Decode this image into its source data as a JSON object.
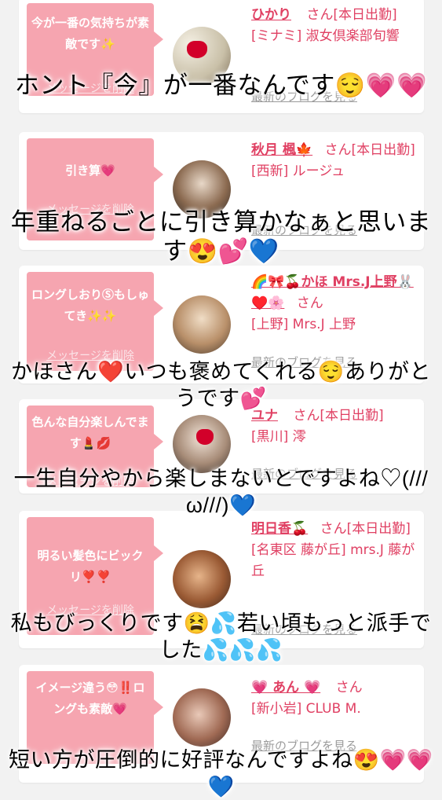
{
  "cards": [
    {
      "bubble_text": "今が一番の気持ちが素敵です✨",
      "delete_label": "メッセージを削除",
      "name": "ひかり",
      "status": "さん[本日出勤]",
      "shop": "[ミナミ] 淑女倶楽部旬響",
      "blog_label": "最新のブログを見る"
    },
    {
      "bubble_text": "引き算💗",
      "delete_label": "メッセージを削除",
      "name": "秋月 楓🍁",
      "status": "さん[本日出勤]",
      "shop": "[西新] ルージュ",
      "blog_label": "最新のブログを見る"
    },
    {
      "bubble_text": "ロングしおりⓈもしゅてき✨✨",
      "delete_label": "メッセージを削除",
      "name": "🌈🎀🍒かほ Mrs.J上野🐰♥️🌸",
      "status": "さん",
      "shop": "[上野] Mrs.J 上野",
      "blog_label": "最新のブログを見る"
    },
    {
      "bubble_text": "色んな自分楽しんでます💄💋",
      "delete_label": "メッセージを削除",
      "name": "ユナ",
      "status": "さん[本日出勤]",
      "shop": "[黒川] 澪",
      "blog_label": "最新のブログを見る"
    },
    {
      "bubble_text": "明るい髪色にビックリ❣️❣️",
      "delete_label": "メッセージを削除",
      "name": "明日香🍒",
      "status": "さん[本日出勤]",
      "shop": "[名東区 藤が丘] mrs.J 藤が丘",
      "blog_label": "最新のブログを見る"
    },
    {
      "bubble_text": "イメージ違う😳‼️ロングも素敵💗",
      "delete_label": "メッセージを削除",
      "name": "💗 あん 💗",
      "status": "さん",
      "shop": "[新小岩] CLUB M.",
      "blog_label": "最新のブログを見る"
    }
  ],
  "captions": [
    "ホント『今』が一番なんです😌💗💗",
    "年重ねるごとに引き算かなぁと思います😍💕💙",
    "かほさん❤️いつも褒めてくれる😌ありがとうです💕",
    "一生自分やから楽しまないとですよね♡(///ω///)💙",
    "私もびっくりです😫💦若い頃もっと派手でした💦💦💦",
    "短い方が圧倒的に好評なんですよね😍💗💗💙"
  ],
  "colors": {
    "accent": "#e04063",
    "bubble": "#f6a5b0",
    "link_gray": "#9a9a9a"
  }
}
